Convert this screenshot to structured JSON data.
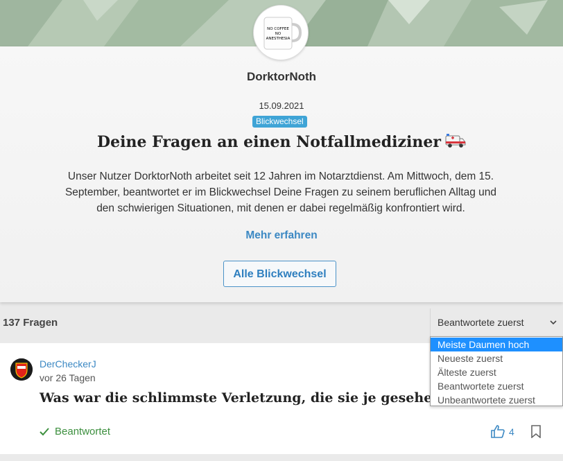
{
  "profile": {
    "username": "DorktorNoth",
    "mug_text_lines": [
      "NO COFFEE",
      "NO",
      "ANESTHESIA"
    ]
  },
  "event": {
    "date": "15.09.2021",
    "tag": "Blickwechsel",
    "title": "Deine Fragen an einen Notfallmediziner",
    "description": "Unser Nutzer DorktorNoth arbeitet seit 12 Jahren im Notarztdienst. Am Mittwoch, dem 15. September, beantwortet er im Blickwechsel Deine Fragen zu seinem beruflichen Alltag und den schwierigen Situationen, mit denen er dabei regelmäßig konfrontiert wird.",
    "more_label": "Mehr erfahren",
    "all_button_label": "Alle Blickwechsel"
  },
  "questions_bar": {
    "count_label": "137 Fragen",
    "sort_selected": "Beantwortete zuerst",
    "sort_options": [
      "Meiste Daumen hoch",
      "Neueste zuerst",
      "Älteste zuerst",
      "Beantwortete zuerst",
      "Unbeantwortete zuerst"
    ],
    "highlighted_option": "Meiste Daumen hoch"
  },
  "question": {
    "author": "DerCheckerJ",
    "time": "vor 26 Tagen",
    "title": "Was war die schlimmste Verletzung, die sie je gesehen haben?",
    "status": "Beantwortet",
    "likes": "4"
  },
  "colors": {
    "link_blue": "#3b88c3",
    "tag_blue": "#3fa4d6",
    "answered_green": "#3c8f3e",
    "dropdown_highlight": "#1e90ff"
  },
  "icons": {
    "headline": "ambulance-icon",
    "sort": "chevron-down-icon",
    "status": "checkmark-icon",
    "likes": "thumbs-up-icon",
    "bookmark": "bookmark-icon"
  }
}
